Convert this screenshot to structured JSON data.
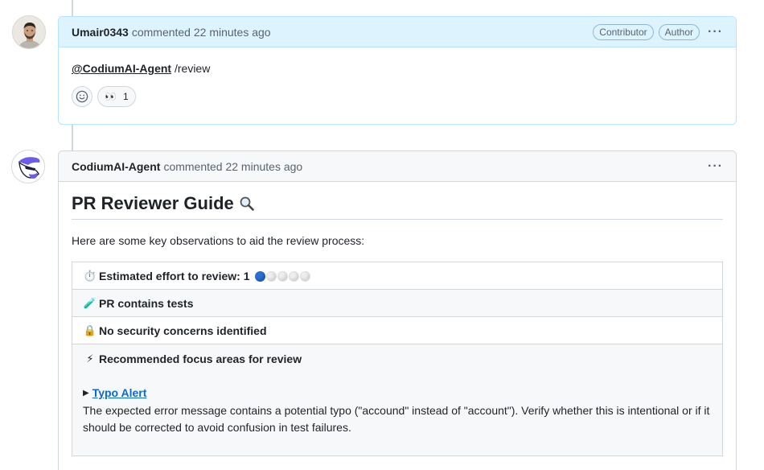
{
  "comment1": {
    "author": "Umair0343",
    "meta": "commented 22 minutes ago",
    "badges": [
      "Contributor",
      "Author"
    ],
    "mention": "@CodiumAI-Agent",
    "text": " /review",
    "reaction_emoji": "👀",
    "reaction_count": "1"
  },
  "comment2": {
    "author": "CodiumAI-Agent",
    "meta": "commented 22 minutes ago",
    "title": "PR Reviewer Guide",
    "title_icon": "magnifier-emoji",
    "intro": "Here are some key observations to aid the review process:",
    "rows": {
      "effort": {
        "icon": "⏱️",
        "label": "Estimated effort to review: 1",
        "score": 1,
        "max": 5
      },
      "tests": {
        "icon": "🧪",
        "label": "PR contains tests"
      },
      "security": {
        "icon": "🔒",
        "label": "No security concerns identified"
      },
      "focus": {
        "icon": "⚡",
        "label": "Recommended focus areas for review"
      }
    },
    "typo": {
      "title": "Typo Alert",
      "desc": "The expected error message contains a potential typo (\"accound\" instead of \"account\"). Verify whether this is intentional or if it should be corrected to avoid confusion in test failures."
    }
  },
  "colors": {
    "accent": "#0969da",
    "header_highlight": "#ddf4ff",
    "effort_dot": "#2a6fd6"
  }
}
